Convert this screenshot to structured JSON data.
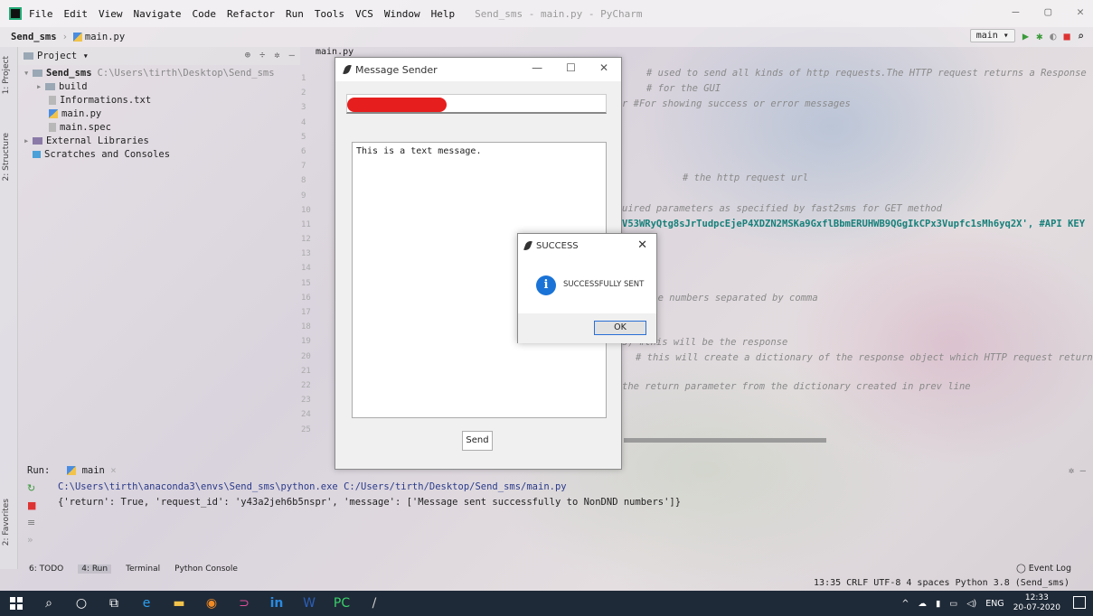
{
  "menubar": {
    "items": [
      "File",
      "Edit",
      "View",
      "Navigate",
      "Code",
      "Refactor",
      "Run",
      "Tools",
      "VCS",
      "Window",
      "Help"
    ],
    "title": "Send_sms - main.py - PyCharm"
  },
  "breadcrumb": {
    "project": "Send_sms",
    "file": "main.py",
    "branch": "main"
  },
  "sidebar_tabs": {
    "project": "1: Project",
    "structure": "2: Structure",
    "favorites": "2: Favorites"
  },
  "project_panel": {
    "header": "Project",
    "tree": [
      {
        "label": "Send_sms",
        "path": "C:\\Users\\tirth\\Desktop\\Send_sms"
      },
      {
        "label": "build"
      },
      {
        "label": "Informations.txt"
      },
      {
        "label": "main.py"
      },
      {
        "label": "main.spec"
      },
      {
        "label": "External Libraries"
      },
      {
        "label": "Scratches and Consoles"
      }
    ]
  },
  "editor": {
    "tab": "main.py",
    "line_numbers": [
      "1",
      "2",
      "3",
      "4",
      "5",
      "6",
      "7",
      "8",
      "9",
      "10",
      "11",
      "12",
      "13",
      "14",
      "15",
      "16",
      "17",
      "18",
      "19",
      "20",
      "21",
      "22",
      "23",
      "24",
      "25"
    ],
    "code": [
      "# used to send all kinds of http requests.The HTTP request returns a Response",
      "# for the GUI",
      "r  #For showing success or error messages",
      "# the http request url",
      "uired parameters as specified by fast2sms for GET method",
      "V53WRyQtg8sJrTudpcEjeP4XDZN2MSKa9GxflBbmERUHWB9QGgIkCPx3Vupfc1sMh6yq2X',  #API KEY",
      "ple numbers separated by comma",
      "s)     #this will be the response",
      "# this will create a dictionary of the response object which HTTP request returns",
      "the return parameter from the dictionary created in prev line"
    ]
  },
  "message_sender": {
    "title": "Message Sender",
    "message_text": "This is a text message.",
    "send_label": "Send"
  },
  "success_dialog": {
    "title": "SUCCESS",
    "message": "SUCCESSFULLY SENT",
    "ok_label": "OK"
  },
  "run_panel": {
    "label": "Run:",
    "config": "main",
    "lines": [
      "C:\\Users\\tirth\\anaconda3\\envs\\Send_sms\\python.exe C:/Users/tirth/Desktop/Send_sms/main.py",
      "{'return': True, 'request_id': 'y43a2jeh6b5nspr', 'message': ['Message sent successfully to NonDND numbers']}"
    ]
  },
  "tool_strip": {
    "items": [
      "6: TODO",
      "4: Run",
      "Terminal",
      "Python Console"
    ],
    "event_log": "Event Log"
  },
  "status_bar": {
    "text": "13:35  CRLF  UTF-8  4 spaces  Python 3.8 (Send_sms)"
  },
  "taskbar": {
    "lang": "ENG",
    "time": "12:33",
    "date": "20-07-2020"
  }
}
